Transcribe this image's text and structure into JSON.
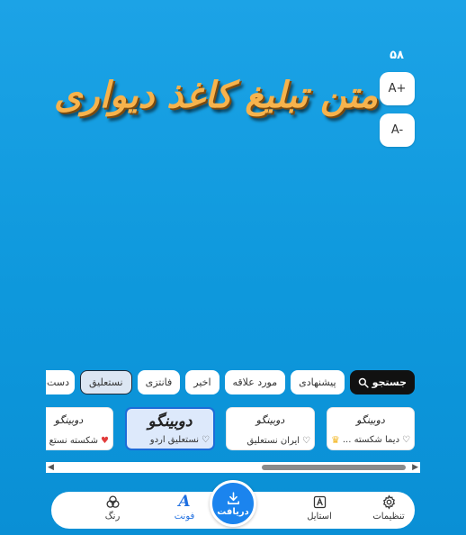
{
  "text_size": {
    "value": "۵۸",
    "increase_label": "A+",
    "decrease_label": "A-"
  },
  "preview": {
    "text": "متن تبلیغ کاغذ دیواری",
    "text_color": "#f7b34c"
  },
  "categories": [
    {
      "label": "جستجو",
      "icon": "search-icon",
      "type": "search"
    },
    {
      "label": "پیشنهادی"
    },
    {
      "label": "مورد علاقه"
    },
    {
      "label": "اخیر"
    },
    {
      "label": "فانتزی"
    },
    {
      "label": "نستعلیق",
      "selected": true
    },
    {
      "label": "دست‌نویس"
    }
  ],
  "font_cards": [
    {
      "sample": "دوبینگو",
      "name": "دیما شکسته ...",
      "favorite": false,
      "premium": true
    },
    {
      "sample": "دوبینگو",
      "name": "ایران نستعلیق",
      "favorite": false,
      "premium": false
    },
    {
      "sample": "دوبینگو",
      "name": "نستعلیق اردو",
      "favorite": false,
      "premium": false,
      "selected": true
    },
    {
      "sample": "دوبینگو",
      "name": "شکسته نستع",
      "favorite": true,
      "premium": false
    }
  ],
  "bottom_nav": {
    "settings": "تنظیمات",
    "style": "استایل",
    "download": "دریافت",
    "font": "فونت",
    "color": "رنگ"
  },
  "colors": {
    "accent": "#1f6fe0",
    "background": "#1ca3e6"
  }
}
